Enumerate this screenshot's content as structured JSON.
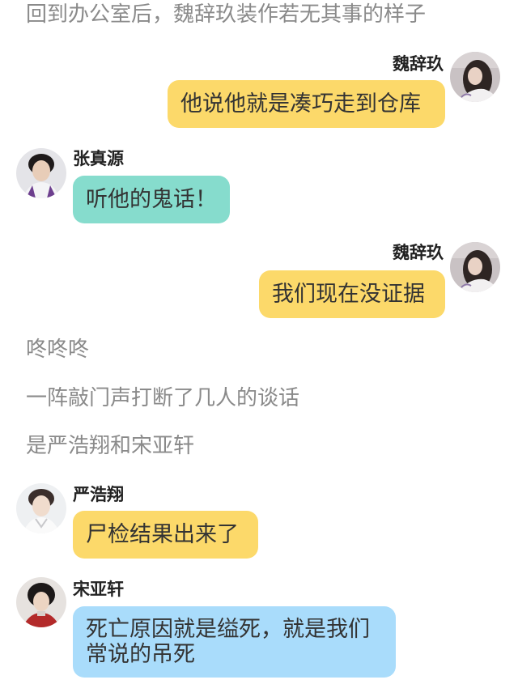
{
  "colors": {
    "bubble_yellow": "#fcd96a",
    "bubble_teal": "#86dccd",
    "bubble_blue": "#a9dcfb",
    "narration": "#8a8a8a"
  },
  "messages": [
    {
      "type": "narration",
      "text": "回到办公室后，魏辞玖装作若无其事的样子"
    },
    {
      "type": "chat",
      "side": "right",
      "speaker": "魏辞玖",
      "avatar": "girl-avatar",
      "text": "他说他就是凑巧走到仓库"
    },
    {
      "type": "chat",
      "side": "left",
      "speaker": "张真源",
      "avatar": "boy-avatar",
      "text": "听他的鬼话！"
    },
    {
      "type": "chat",
      "side": "right",
      "speaker": "魏辞玖",
      "avatar": "girl-avatar",
      "text": "我们现在没证据"
    },
    {
      "type": "narration",
      "text": "咚咚咚"
    },
    {
      "type": "narration",
      "text": "一阵敲门声打断了几人的谈话"
    },
    {
      "type": "narration",
      "text": "是严浩翔和宋亚轩"
    },
    {
      "type": "chat",
      "side": "left",
      "speaker": "严浩翔",
      "avatar": "boy-avatar",
      "text": "尸检结果出来了"
    },
    {
      "type": "chat",
      "side": "left",
      "speaker": "宋亚轩",
      "avatar": "boy-avatar",
      "text_lines": [
        "死亡原因就是缢死，就是我们",
        "常说的吊死"
      ]
    }
  ]
}
